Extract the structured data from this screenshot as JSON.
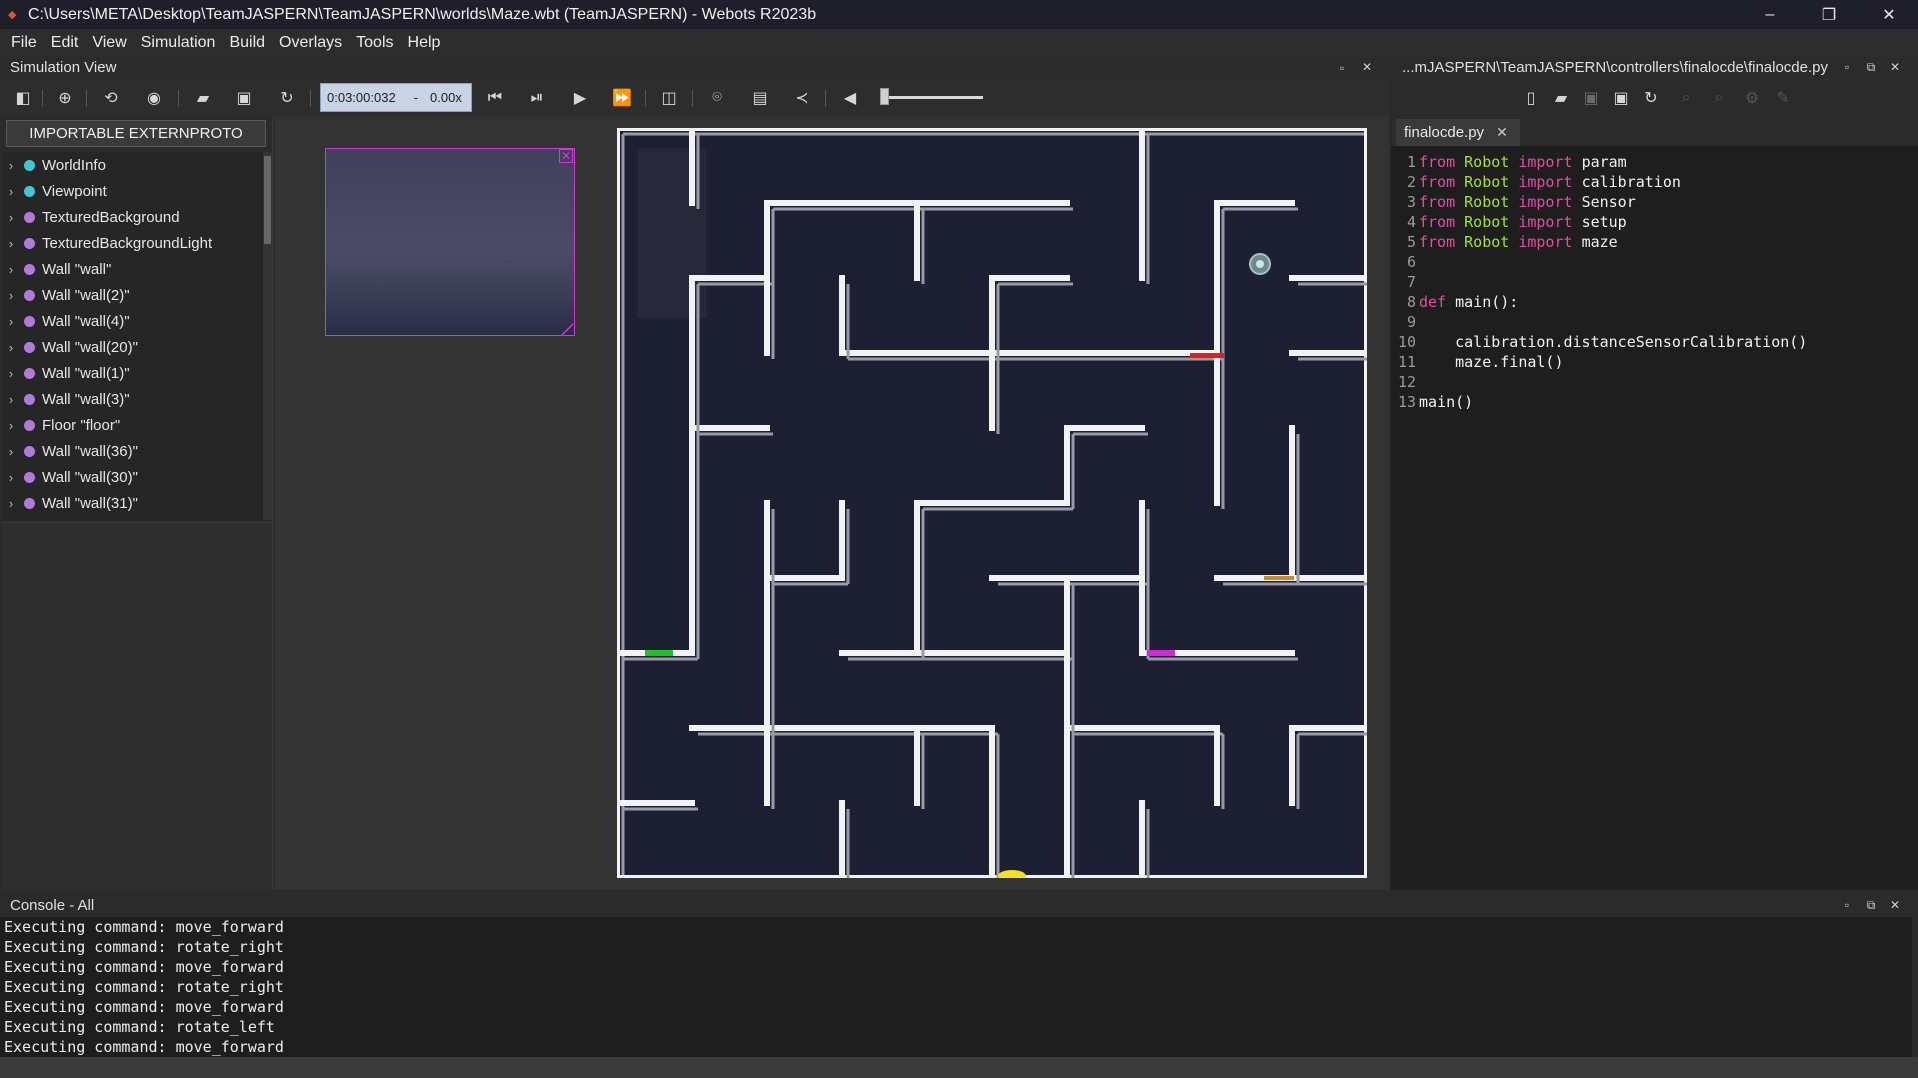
{
  "window": {
    "title": "C:\\Users\\META\\Desktop\\TeamJASPERN\\TeamJASPERN\\worlds\\Maze.wbt (TeamJASPERN) - Webots R2023b",
    "controls": [
      "–",
      "❐",
      "✕"
    ]
  },
  "menu": [
    "File",
    "Edit",
    "View",
    "Simulation",
    "Build",
    "Overlays",
    "Tools",
    "Help"
  ],
  "simulation_view": {
    "title": "Simulation View",
    "time": "0:03:00:032",
    "separator": "-",
    "speed": "0.00x"
  },
  "scene_tree": {
    "extern_button": "IMPORTABLE EXTERNPROTO",
    "items": [
      {
        "label": "WorldInfo",
        "color": "#3fc7d6"
      },
      {
        "label": "Viewpoint",
        "color": "#3fc7d6"
      },
      {
        "label": "TexturedBackground",
        "color": "#b07adb"
      },
      {
        "label": "TexturedBackgroundLight",
        "color": "#b07adb"
      },
      {
        "label": "Wall \"wall\"",
        "color": "#b07adb"
      },
      {
        "label": "Wall \"wall(2)\"",
        "color": "#b07adb"
      },
      {
        "label": "Wall \"wall(4)\"",
        "color": "#b07adb"
      },
      {
        "label": "Wall \"wall(20)\"",
        "color": "#b07adb"
      },
      {
        "label": "Wall \"wall(1)\"",
        "color": "#b07adb"
      },
      {
        "label": "Wall \"wall(3)\"",
        "color": "#b07adb"
      },
      {
        "label": "Floor \"floor\"",
        "color": "#b07adb"
      },
      {
        "label": "Wall \"wall(36)\"",
        "color": "#b07adb"
      },
      {
        "label": "Wall \"wall(30)\"",
        "color": "#b07adb"
      },
      {
        "label": "Wall \"wall(31)\"",
        "color": "#b07adb"
      }
    ]
  },
  "editor": {
    "path_title": "...mJASPERN\\TeamJASPERN\\controllers\\finalocde\\finalocde.py",
    "tab": "finalocde.py",
    "lines": [
      {
        "n": "1",
        "a": "from",
        "b": "Robot",
        "c": "import",
        "d": "param"
      },
      {
        "n": "2",
        "a": "from",
        "b": "Robot",
        "c": "import",
        "d": "calibration"
      },
      {
        "n": "3",
        "a": "from",
        "b": "Robot",
        "c": "import",
        "d": "Sensor"
      },
      {
        "n": "4",
        "a": "from",
        "b": "Robot",
        "c": "import",
        "d": "setup"
      },
      {
        "n": "5",
        "a": "from",
        "b": "Robot",
        "c": "import",
        "d": "maze"
      },
      {
        "n": "6"
      },
      {
        "n": "7"
      },
      {
        "n": "8",
        "a": "def",
        "d": "main():"
      },
      {
        "n": "9"
      },
      {
        "n": "10",
        "d": "    calibration.distanceSensorCalibration()"
      },
      {
        "n": "11",
        "d": "    maze.final()"
      },
      {
        "n": "12"
      },
      {
        "n": "13",
        "d": "main()"
      }
    ]
  },
  "console": {
    "title": "Console - All",
    "lines": [
      "Executing command: move_forward",
      "Executing command: rotate_right",
      "Executing command: move_forward",
      "Executing command: rotate_right",
      "Executing command: move_forward",
      "Executing command: rotate_left",
      "Executing command: move_forward"
    ]
  },
  "colors": {
    "wall": "#f2f2f2",
    "floor": "#1d2033",
    "marker_red": "#e02020",
    "marker_green": "#22c02a",
    "marker_magenta": "#d22ad2",
    "marker_orange": "#c98a2a",
    "marker_yellow": "#f2e21a"
  }
}
